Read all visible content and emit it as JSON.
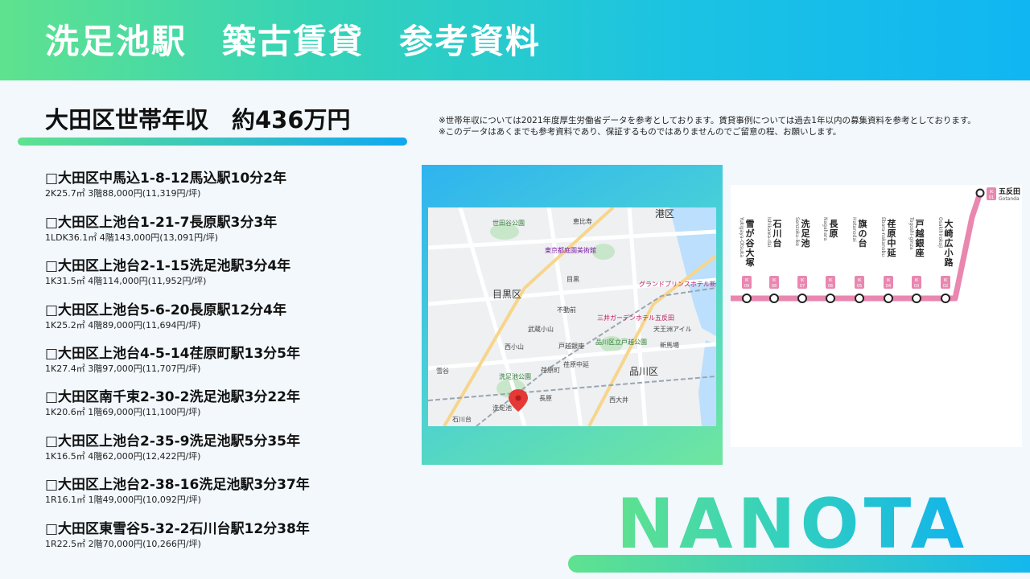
{
  "header": {
    "title": "洗足池駅　築古賃貸　参考資料"
  },
  "income": {
    "text": "大田区世帯年収　約436万円"
  },
  "notes": [
    "※世帯年収については2021年度厚生労働省データを参考としております。賃貸事例については過去1年以内の募集資料を参考としております。",
    "※このデータはあくまでも参考資料であり、保証するものではありませんのでご留意の程、お願いします。"
  ],
  "listings": [
    {
      "title": "□大田区中馬込1-8-12馬込駅10分2年",
      "detail": "2K25.7㎡ 3階88,000円(11,319円/坪)"
    },
    {
      "title": "□大田区上池台1-21-7長原駅3分3年",
      "detail": "1LDK36.1㎡ 4階143,000円(13,091円/坪)"
    },
    {
      "title": "□大田区上池台2-1-15洗足池駅3分4年",
      "detail": "1K31.5㎡ 4階114,000円(11,952円/坪)"
    },
    {
      "title": "□大田区上池台5-6-20長原駅12分4年",
      "detail": "1K25.2㎡ 4階89,000円(11,694円/坪)"
    },
    {
      "title": "□大田区上池台4-5-14荏原町駅13分5年",
      "detail": "1K27.4㎡ 3階97,000円(11,707円/坪)"
    },
    {
      "title": "□大田区南千束2-30-2洗足池駅3分22年",
      "detail": "1K20.6㎡ 1階69,000円(11,100円/坪)"
    },
    {
      "title": "□大田区上池台2-35-9洗足池駅5分35年",
      "detail": "1K16.5㎡ 4階62,000円(12,422円/坪)"
    },
    {
      "title": "□大田区上池台2-38-16洗足池駅3分37年",
      "detail": "1R16.1㎡ 1階49,000円(10,092円/坪)"
    },
    {
      "title": "□大田区東雪谷5-32-2石川台駅12分38年",
      "detail": "1R22.5㎡ 2階70,000円(10,266円/坪)"
    }
  ],
  "map": {
    "labels": {
      "ward_meguro": "目黒区",
      "ward_shinagawa": "品川区",
      "ward_minato": "港区",
      "park_setagaya": "世田谷公園",
      "museum": "東京都庭園美術館",
      "station_senzokuike": "洗足池",
      "park_senzokuike": "洗足池公園",
      "station_nagahara": "長原",
      "station_ishikawadai": "石川台",
      "hotel": "グランドプリンスホテル新高輪",
      "garden": "三井ガーデンホテル五反田",
      "togoshi_park": "品川区立戸越公園",
      "ebara": "荏原町",
      "oimachi": "西大井",
      "tennozu": "天王洲アイル",
      "shinbaba": "新馬場",
      "nishikoyama": "西小山",
      "musashikoyama": "武蔵小山",
      "togoshiginza": "戸越銀座",
      "ebaranakanobu": "荏原中延",
      "yukigaya": "雪谷",
      "fudomae": "不動前",
      "meguro": "目黒",
      "ebisu": "恵比寿"
    }
  },
  "route": {
    "line_code": "IK",
    "terminal": {
      "name": "五反田",
      "roman": "Gotanda",
      "code": "01"
    },
    "stations": [
      {
        "name": "雪が谷大塚",
        "roman": "Yukigaya-Otsuka",
        "code": "09"
      },
      {
        "name": "石川台",
        "roman": "Ishikawa-dai",
        "code": "08"
      },
      {
        "name": "洗足池",
        "roman": "Senzoku-ike",
        "code": "07"
      },
      {
        "name": "長原",
        "roman": "Nagahara",
        "code": "06"
      },
      {
        "name": "旗の台",
        "roman": "Hatanodai",
        "code": "05"
      },
      {
        "name": "荏原中延",
        "roman": "Ebara-nakanobu",
        "code": "04"
      },
      {
        "name": "戸越銀座",
        "roman": "Togoshi-ginza",
        "code": "03"
      },
      {
        "name": "大崎広小路",
        "roman": "Osakihirokoji",
        "code": "02"
      }
    ],
    "line_color": "#e987b0"
  },
  "brand": {
    "logo_text": "NANOTA"
  }
}
